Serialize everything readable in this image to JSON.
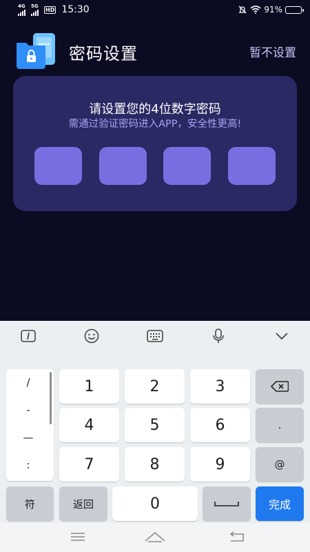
{
  "status_bar": {
    "net1": "4G",
    "net2": "5G",
    "hd": "HD",
    "time": "15:30",
    "battery": "91%",
    "battery_level": 0.91
  },
  "header": {
    "title": "密码设置",
    "skip_label": "暂不设置",
    "app_icon": "lock-folder-icon"
  },
  "pin_card": {
    "heading": "请设置您的4位数字密码",
    "subtitle": "需通过验证密码进入APP，安全性更高!",
    "digits_entered": 0,
    "digits_total": 4
  },
  "keyboard": {
    "toolbar": [
      "text-cursor-icon",
      "emoji-icon",
      "keyboard-icon",
      "microphone-icon",
      "chevron-down-icon"
    ],
    "symbols": [
      "/",
      "-",
      "—",
      ":"
    ],
    "digits": [
      "1",
      "2",
      "3",
      "4",
      "5",
      "6",
      "7",
      "8",
      "9",
      "0"
    ],
    "dot": ".",
    "at": "@",
    "symbol_label": "符",
    "back_label": "返回",
    "done_label": "完成",
    "backspace_icon": "backspace-icon",
    "space_icon": "space-bar-icon"
  },
  "nav_bar": [
    "menu-icon",
    "home-icon",
    "back-icon"
  ],
  "colors": {
    "background": "#0b0b22",
    "card": "#2a2963",
    "pin_box": "#776fe1",
    "accent_text": "#a6a3f2",
    "done_key": "#1f7af0"
  }
}
